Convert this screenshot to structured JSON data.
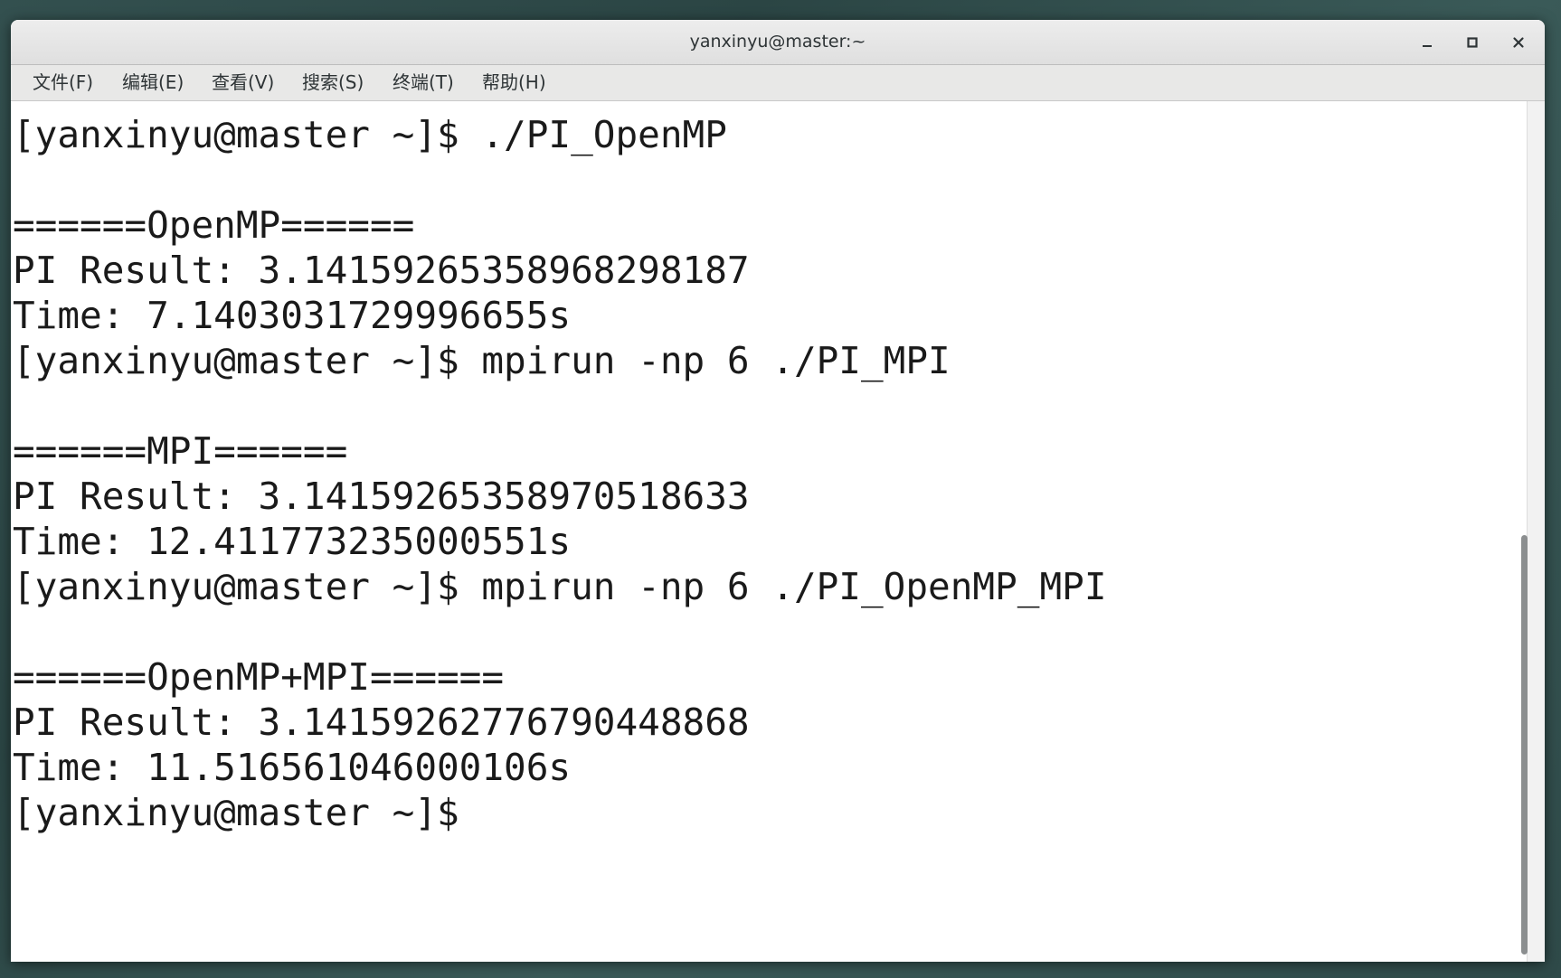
{
  "window": {
    "title": "yanxinyu@master:~",
    "buttons": {
      "minimize_icon": "minimize-icon",
      "maximize_icon": "maximize-icon",
      "close_icon": "close-icon"
    }
  },
  "menu": {
    "items": [
      {
        "label": "文件(F)"
      },
      {
        "label": "编辑(E)"
      },
      {
        "label": "查看(V)"
      },
      {
        "label": "搜索(S)"
      },
      {
        "label": "终端(T)"
      },
      {
        "label": "帮助(H)"
      }
    ]
  },
  "terminal": {
    "lines": [
      "[yanxinyu@master ~]$ ./PI_OpenMP",
      "",
      "======OpenMP======",
      "PI Result: 3.14159265358968298187",
      "Time: 7.1403031729996655s",
      "[yanxinyu@master ~]$ mpirun -np 6 ./PI_MPI",
      "",
      "======MPI======",
      "PI Result: 3.14159265358970518633",
      "Time: 12.411773235000551s",
      "[yanxinyu@master ~]$ mpirun -np 6 ./PI_OpenMP_MPI",
      "",
      "======OpenMP+MPI======",
      "PI Result: 3.14159262776790448868",
      "Time: 11.516561046000106s",
      "[yanxinyu@master ~]$ "
    ]
  },
  "colors": {
    "terminal_background": "#ffffff",
    "terminal_text": "#1a1a1a",
    "titlebar": "#e6e6e6",
    "desktop": "#33504f"
  }
}
